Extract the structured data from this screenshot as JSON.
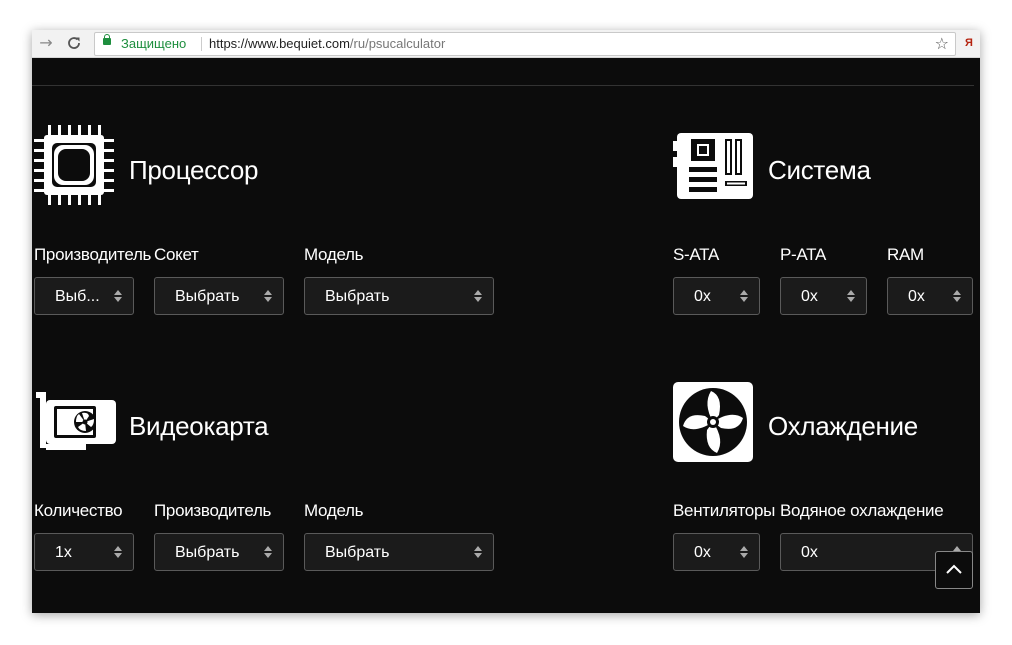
{
  "browser": {
    "secure_label": "Защищено",
    "url_host": "https://www.bequiet.com",
    "url_path": "/ru/psucalculator",
    "extension_letter": "Я"
  },
  "icons": {
    "back": "back-arrow-icon",
    "reload": "reload-icon",
    "lock": "lock-icon",
    "bookmark": "star-icon",
    "cpu": "cpu-icon",
    "motherboard": "motherboard-icon",
    "gpu": "graphics-card-icon",
    "fan": "fan-icon",
    "select": "select-arrows-icon",
    "scroll_top": "chevron-up-icon"
  },
  "colors": {
    "background": "#0c0c0c",
    "text": "#ffffff",
    "field_border": "#5a5a5a"
  },
  "processor": {
    "title": "Процессор",
    "fields": [
      {
        "label": "Производитель",
        "value": "Выб..."
      },
      {
        "label": "Сокет",
        "value": "Выбрать"
      },
      {
        "label": "Модель",
        "value": "Выбрать"
      }
    ]
  },
  "system": {
    "title": "Система",
    "fields": [
      {
        "label": "S-ATA",
        "value": "0x"
      },
      {
        "label": "P-ATA",
        "value": "0x"
      },
      {
        "label": "RAM",
        "value": "0x"
      }
    ]
  },
  "gpu": {
    "title": "Видеокарта",
    "fields": [
      {
        "label": "Количество",
        "value": "1x"
      },
      {
        "label": "Производитель",
        "value": "Выбрать"
      },
      {
        "label": "Модель",
        "value": "Выбрать"
      }
    ]
  },
  "cooling": {
    "title": "Охлаждение",
    "fields": [
      {
        "label": "Вентиляторы",
        "value": "0x"
      },
      {
        "label": "Водяное охлаждение",
        "value": "0x"
      }
    ]
  }
}
